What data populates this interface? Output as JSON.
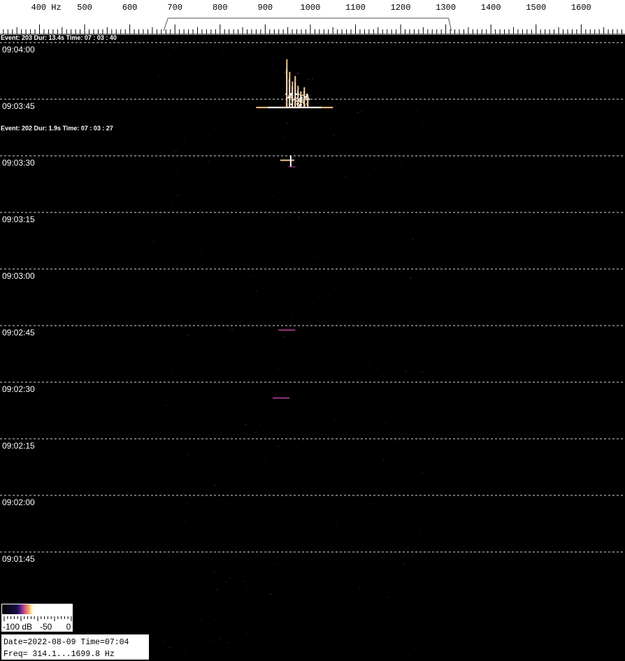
{
  "chart_data": {
    "type": "heatmap",
    "title": "",
    "x_axis": {
      "unit": "Hz",
      "tick_labels": [
        "400",
        "500",
        "600",
        "700",
        "800",
        "900",
        "1000",
        "1100",
        "1200",
        "1300",
        "1400",
        "1500",
        "1600"
      ],
      "first_label": "400 Hz",
      "range_hz": [
        314.1,
        1699.8
      ],
      "bracket_hz": [
        700,
        1300
      ]
    },
    "y_axis": {
      "time_labels": [
        "09:04:00",
        "09:03:45",
        "09:03:30",
        "09:03:15",
        "09:03:00",
        "09:02:45",
        "09:02:30",
        "09:02:15",
        "09:02:00",
        "09:01:45"
      ],
      "grid_lines": "dashed",
      "direction": "time increases upward"
    },
    "events": [
      {
        "label": "Event: 203  Dur:  13.4s  Time:  07 : 03 : 40",
        "freq_hz": 965,
        "duration_s": 13.4,
        "brightness": "high"
      },
      {
        "label": "Event: 202  Dur:  1.9s  Time:  07 : 03 : 27",
        "freq_hz": 955,
        "duration_s": 1.9,
        "brightness": "medium"
      }
    ],
    "faint_traces": [
      {
        "freq_hz": 948,
        "time": "09:02:44"
      },
      {
        "freq_hz": 935,
        "time": "09:02:26"
      }
    ],
    "colorbar": {
      "labels": [
        "-100 dB",
        "-50",
        "0"
      ],
      "colors": [
        "#000000",
        "#1a0f4a",
        "#6b2a8c",
        "#d6509b",
        "#f5a24a",
        "#fff6d0",
        "#ffffff"
      ]
    },
    "info_box": {
      "line1": "Date=2022-08-09 Time=07:04",
      "line2": "Freq= 314.1...1699.8 Hz"
    },
    "colors": {
      "background": "#000000",
      "axis_background": "#ffffff",
      "grid": "#ffffff",
      "text": "#ffffff",
      "signal_core": "#ffffff",
      "signal_mid": "#f5c98a",
      "signal_edge": "#b23a8e",
      "noise": "#1a1050"
    }
  }
}
